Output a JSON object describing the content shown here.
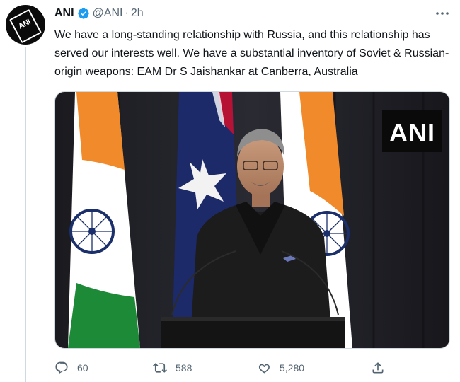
{
  "tweet": {
    "author_name": "ANI",
    "author_handle": "@ANI",
    "separator": "·",
    "time": "2h",
    "avatar_text": "ANI",
    "text": "We have a long-standing relationship with Russia, and this relationship has served our interests well. We have a substantial inventory of Soviet & Russian-origin weapons: EAM Dr S Jaishankar at Canberra, Australia",
    "media": {
      "watermark": "ANI"
    },
    "actions": {
      "replies": "60",
      "retweets": "588",
      "likes": "5,280"
    }
  },
  "icons": {
    "verified": "verified-badge-icon",
    "more": "more-options-icon",
    "reply": "reply-icon",
    "retweet": "retweet-icon",
    "like": "heart-icon",
    "share": "share-icon"
  },
  "colors": {
    "verified": "#1d9bf0",
    "secondary_text": "#536471",
    "saffron": "#f18a2a",
    "india_green": "#1c8a37",
    "chakra_blue": "#1b2f6b",
    "australia_blue": "#1c2a6a"
  }
}
